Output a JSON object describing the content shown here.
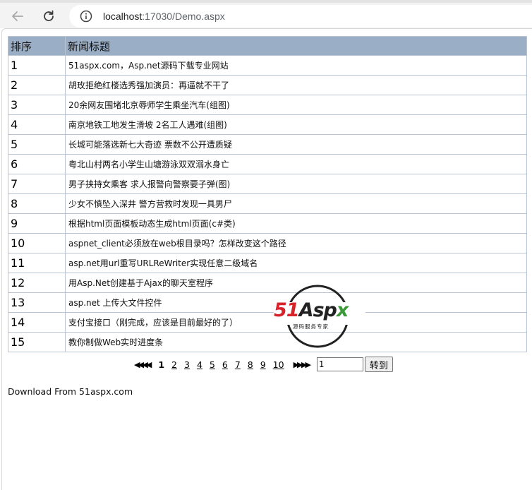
{
  "browser": {
    "url_host": "localhost",
    "url_rest": ":17030/Demo.aspx"
  },
  "table": {
    "headers": [
      "排序",
      "新闻标题"
    ],
    "rows": [
      {
        "rank": "1",
        "title": "51aspx.com，Asp.net源码下载专业网站"
      },
      {
        "rank": "2",
        "title": "胡玫拒绝红楼选秀强加演员：再逼就不干了"
      },
      {
        "rank": "3",
        "title": "20余网友围堵北京辱师学生乘坐汽车(组图)"
      },
      {
        "rank": "4",
        "title": "南京地铁工地发生滑坡 2名工人遇难(组图)"
      },
      {
        "rank": "5",
        "title": "长城可能落选新七大奇迹 票数不公开遭质疑"
      },
      {
        "rank": "6",
        "title": "粤北山村两名小学生山塘游泳双双溺水身亡"
      },
      {
        "rank": "7",
        "title": "男子挟持女乘客 求人报警向警察要子弹(图)"
      },
      {
        "rank": "8",
        "title": "少女不慎坠入深井 警方营救时发现一具男尸"
      },
      {
        "rank": "9",
        "title": "根据html页面模板动态生成html页面(c#类)"
      },
      {
        "rank": "10",
        "title": "aspnet_client必须放在web根目录吗？怎样改变这个路径"
      },
      {
        "rank": "11",
        "title": "asp.net用url重写URLReWriter实现任意二级域名"
      },
      {
        "rank": "12",
        "title": "用Asp.Net创建基于Ajax的聊天室程序"
      },
      {
        "rank": "13",
        "title": "asp.net 上传大文件控件"
      },
      {
        "rank": "14",
        "title": "支付宝接口（刚完成，应该是目前最好的了）"
      },
      {
        "rank": "15",
        "title": "教你制做Web实时进度条"
      }
    ]
  },
  "pager": {
    "first_prev": "◀◀ ◀◀",
    "pages": [
      "1",
      "2",
      "3",
      "4",
      "5",
      "6",
      "7",
      "8",
      "9",
      "10"
    ],
    "current": "1",
    "next_last": "▶▶ ▶▶",
    "input_value": "1",
    "go_label": "转到"
  },
  "footer": {
    "text": "Download From 51aspx.com"
  },
  "watermark": {
    "logo_text": "51Aspx",
    "logo_sub": "源码服务专家"
  }
}
